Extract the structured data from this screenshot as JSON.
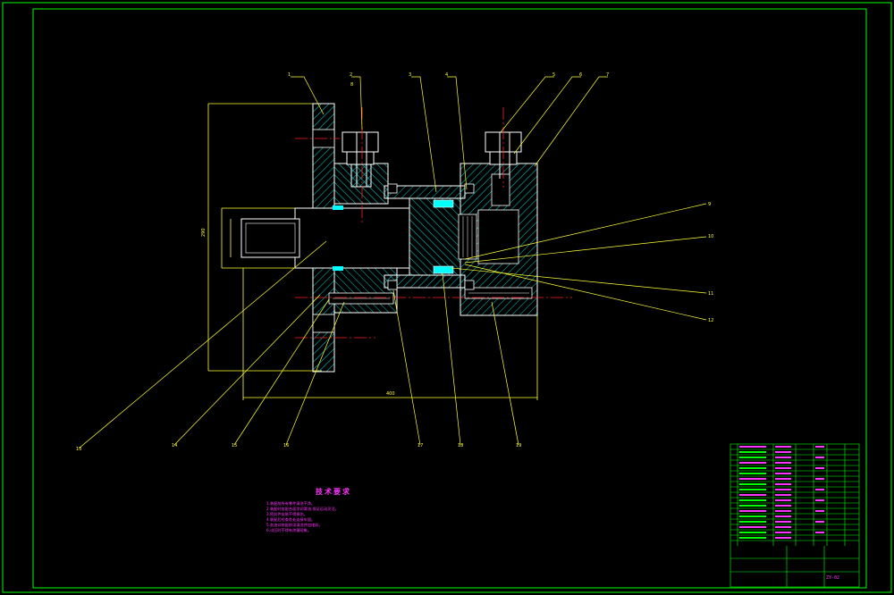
{
  "colors": {
    "background": "#000000",
    "frame": "#00ff00",
    "outline": "#ffffff",
    "hatch": "#00cccc",
    "leader": "#ffff33",
    "centerline": "#ff2222",
    "note_text": "#ff33ff"
  },
  "tech_notes": {
    "title": "技术要求",
    "lines": [
      "1.装配前所有零件清洗干净。",
      "2.装配时各配合面涂润滑油,保证运动灵活。",
      "3.密封件安装不得损伤。",
      "4.装配后检查各处连接牢固。",
      "5.各油口装配前须清洗并加堵封。",
      "6.试压时不得有渗漏现象。"
    ]
  },
  "balloons": {
    "top": [
      "1",
      "2",
      "3",
      "4",
      "5",
      "6",
      "7",
      "8"
    ],
    "right": [
      "9",
      "10",
      "11",
      "12"
    ],
    "bottom": [
      "13",
      "14",
      "15",
      "16",
      "17",
      "18",
      "19"
    ]
  },
  "dimensions": {
    "overall_height": "290",
    "overall_width": "400"
  },
  "title_block": {
    "drawing_code": "ZY-02"
  },
  "icons": {
    "title_block": "parts-list-table-icon"
  }
}
